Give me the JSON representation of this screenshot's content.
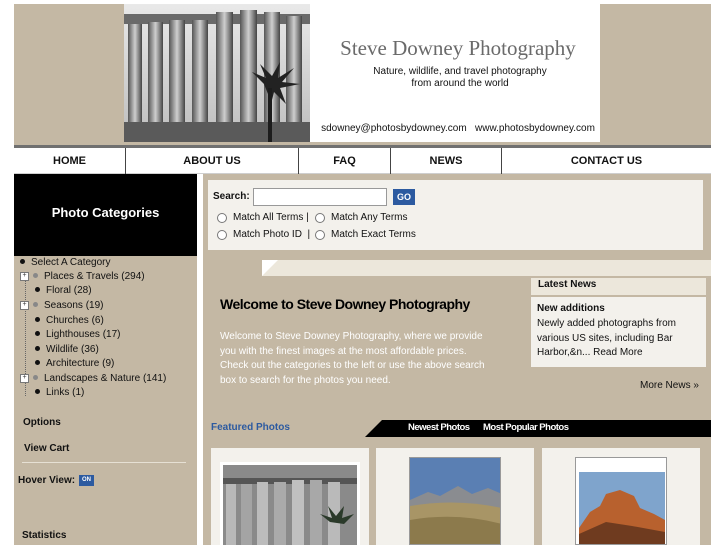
{
  "header": {
    "title": "Steve Downey Photography",
    "tagline_1": "Nature, wildlife, and travel photography",
    "tagline_2": "from around the world",
    "contact": "sdowney@photosbydowney.com   www.photosbydowney.com"
  },
  "nav": {
    "items": [
      {
        "label": "HOME"
      },
      {
        "label": "ABOUT US"
      },
      {
        "label": "FAQ"
      },
      {
        "label": "NEWS"
      },
      {
        "label": "CONTACT US"
      }
    ]
  },
  "sidebar": {
    "categories_title": "Photo Categories",
    "select_label": "Select A Category",
    "categories": [
      {
        "label": "Places & Travels (294)",
        "expandable": true
      },
      {
        "label": "Floral (28)",
        "expandable": false
      },
      {
        "label": "Seasons (19)",
        "expandable": true
      },
      {
        "label": "Churches (6)",
        "expandable": false
      },
      {
        "label": "Lighthouses (17)",
        "expandable": false
      },
      {
        "label": "Wildlife (36)",
        "expandable": false
      },
      {
        "label": "Architecture (9)",
        "expandable": false
      },
      {
        "label": "Landscapes & Nature (141)",
        "expandable": true
      },
      {
        "label": "Links (1)",
        "expandable": false
      }
    ],
    "options_label": "Options",
    "view_cart_label": "View Cart",
    "hover_view_label": "Hover View:",
    "hover_view_state": "ON",
    "statistics_label": "Statistics"
  },
  "search": {
    "label": "Search:",
    "placeholder": "",
    "go_label": "GO",
    "options": {
      "all": "Match All Terms |",
      "any": "Match Any Terms",
      "id": "Match Photo ID  |",
      "exact": "Match Exact Terms"
    }
  },
  "welcome": {
    "title": "Welcome to Steve Downey Photography",
    "text": "Welcome to Steve Downey Photography, where we provide you with the finest images at the most affordable prices. Check out the categories to the left or use the above search box to search for the photos you need."
  },
  "news": {
    "title": "Latest News",
    "heading": "New additions",
    "text": "Newly added photographs from various US sites, including Bar Harbor,&n... Read More",
    "more": "More News »"
  },
  "featured": {
    "label": "Featured Photos",
    "tabs": [
      "Newest Photos",
      "Most Popular Photos"
    ]
  },
  "colors": {
    "tan": "#c4b8a4",
    "accent_blue": "#2c5aa0",
    "cream": "#f3f1ec"
  }
}
